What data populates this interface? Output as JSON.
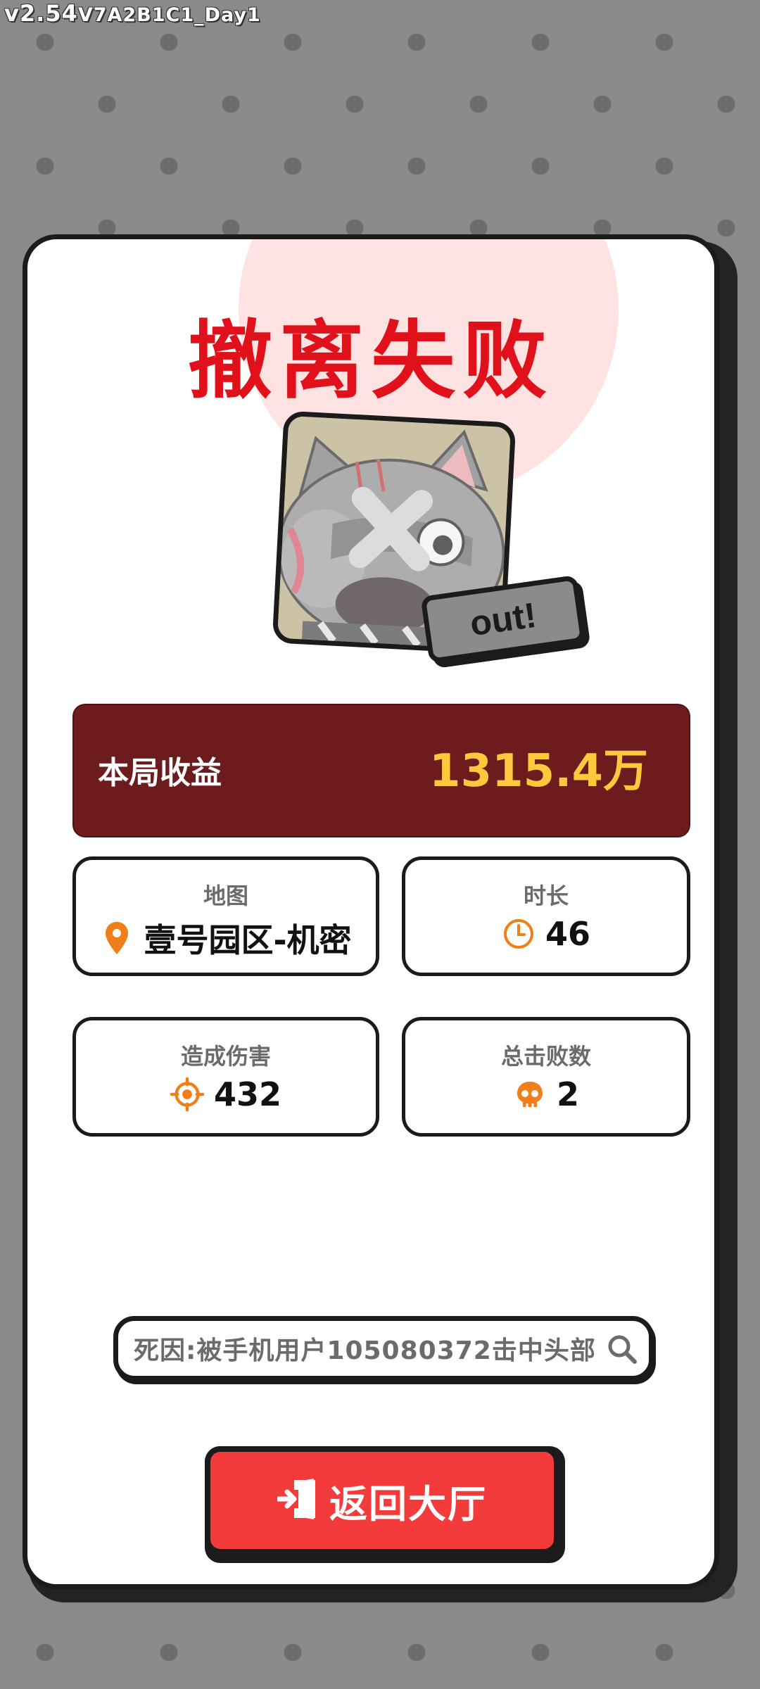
{
  "version": {
    "prefix": "v2.54",
    "build": "V7A2B1C1_Day1"
  },
  "result": {
    "title": "撤离失败",
    "badge": "out!"
  },
  "earnings": {
    "label": "本局收益",
    "value": "1315.4万"
  },
  "stats": {
    "map": {
      "label": "地图",
      "value": "壹号园区-机密",
      "icon": "location-pin-icon"
    },
    "duration": {
      "label": "时长",
      "value": "46",
      "icon": "clock-icon"
    },
    "damage": {
      "label": "造成伤害",
      "value": "432",
      "icon": "crosshair-icon"
    },
    "kills": {
      "label": "总击败数",
      "value": "2",
      "icon": "skull-icon"
    }
  },
  "death": {
    "text": "死因:被手机用户105080372击中头部"
  },
  "return_button": {
    "label": "返回大厅"
  },
  "colors": {
    "title_red": "#e0111b",
    "earnings_bg": "#6d1c1e",
    "earnings_gold": "#ffc83d",
    "icon_orange": "#f07f1a",
    "button_red": "#f33b3b"
  }
}
